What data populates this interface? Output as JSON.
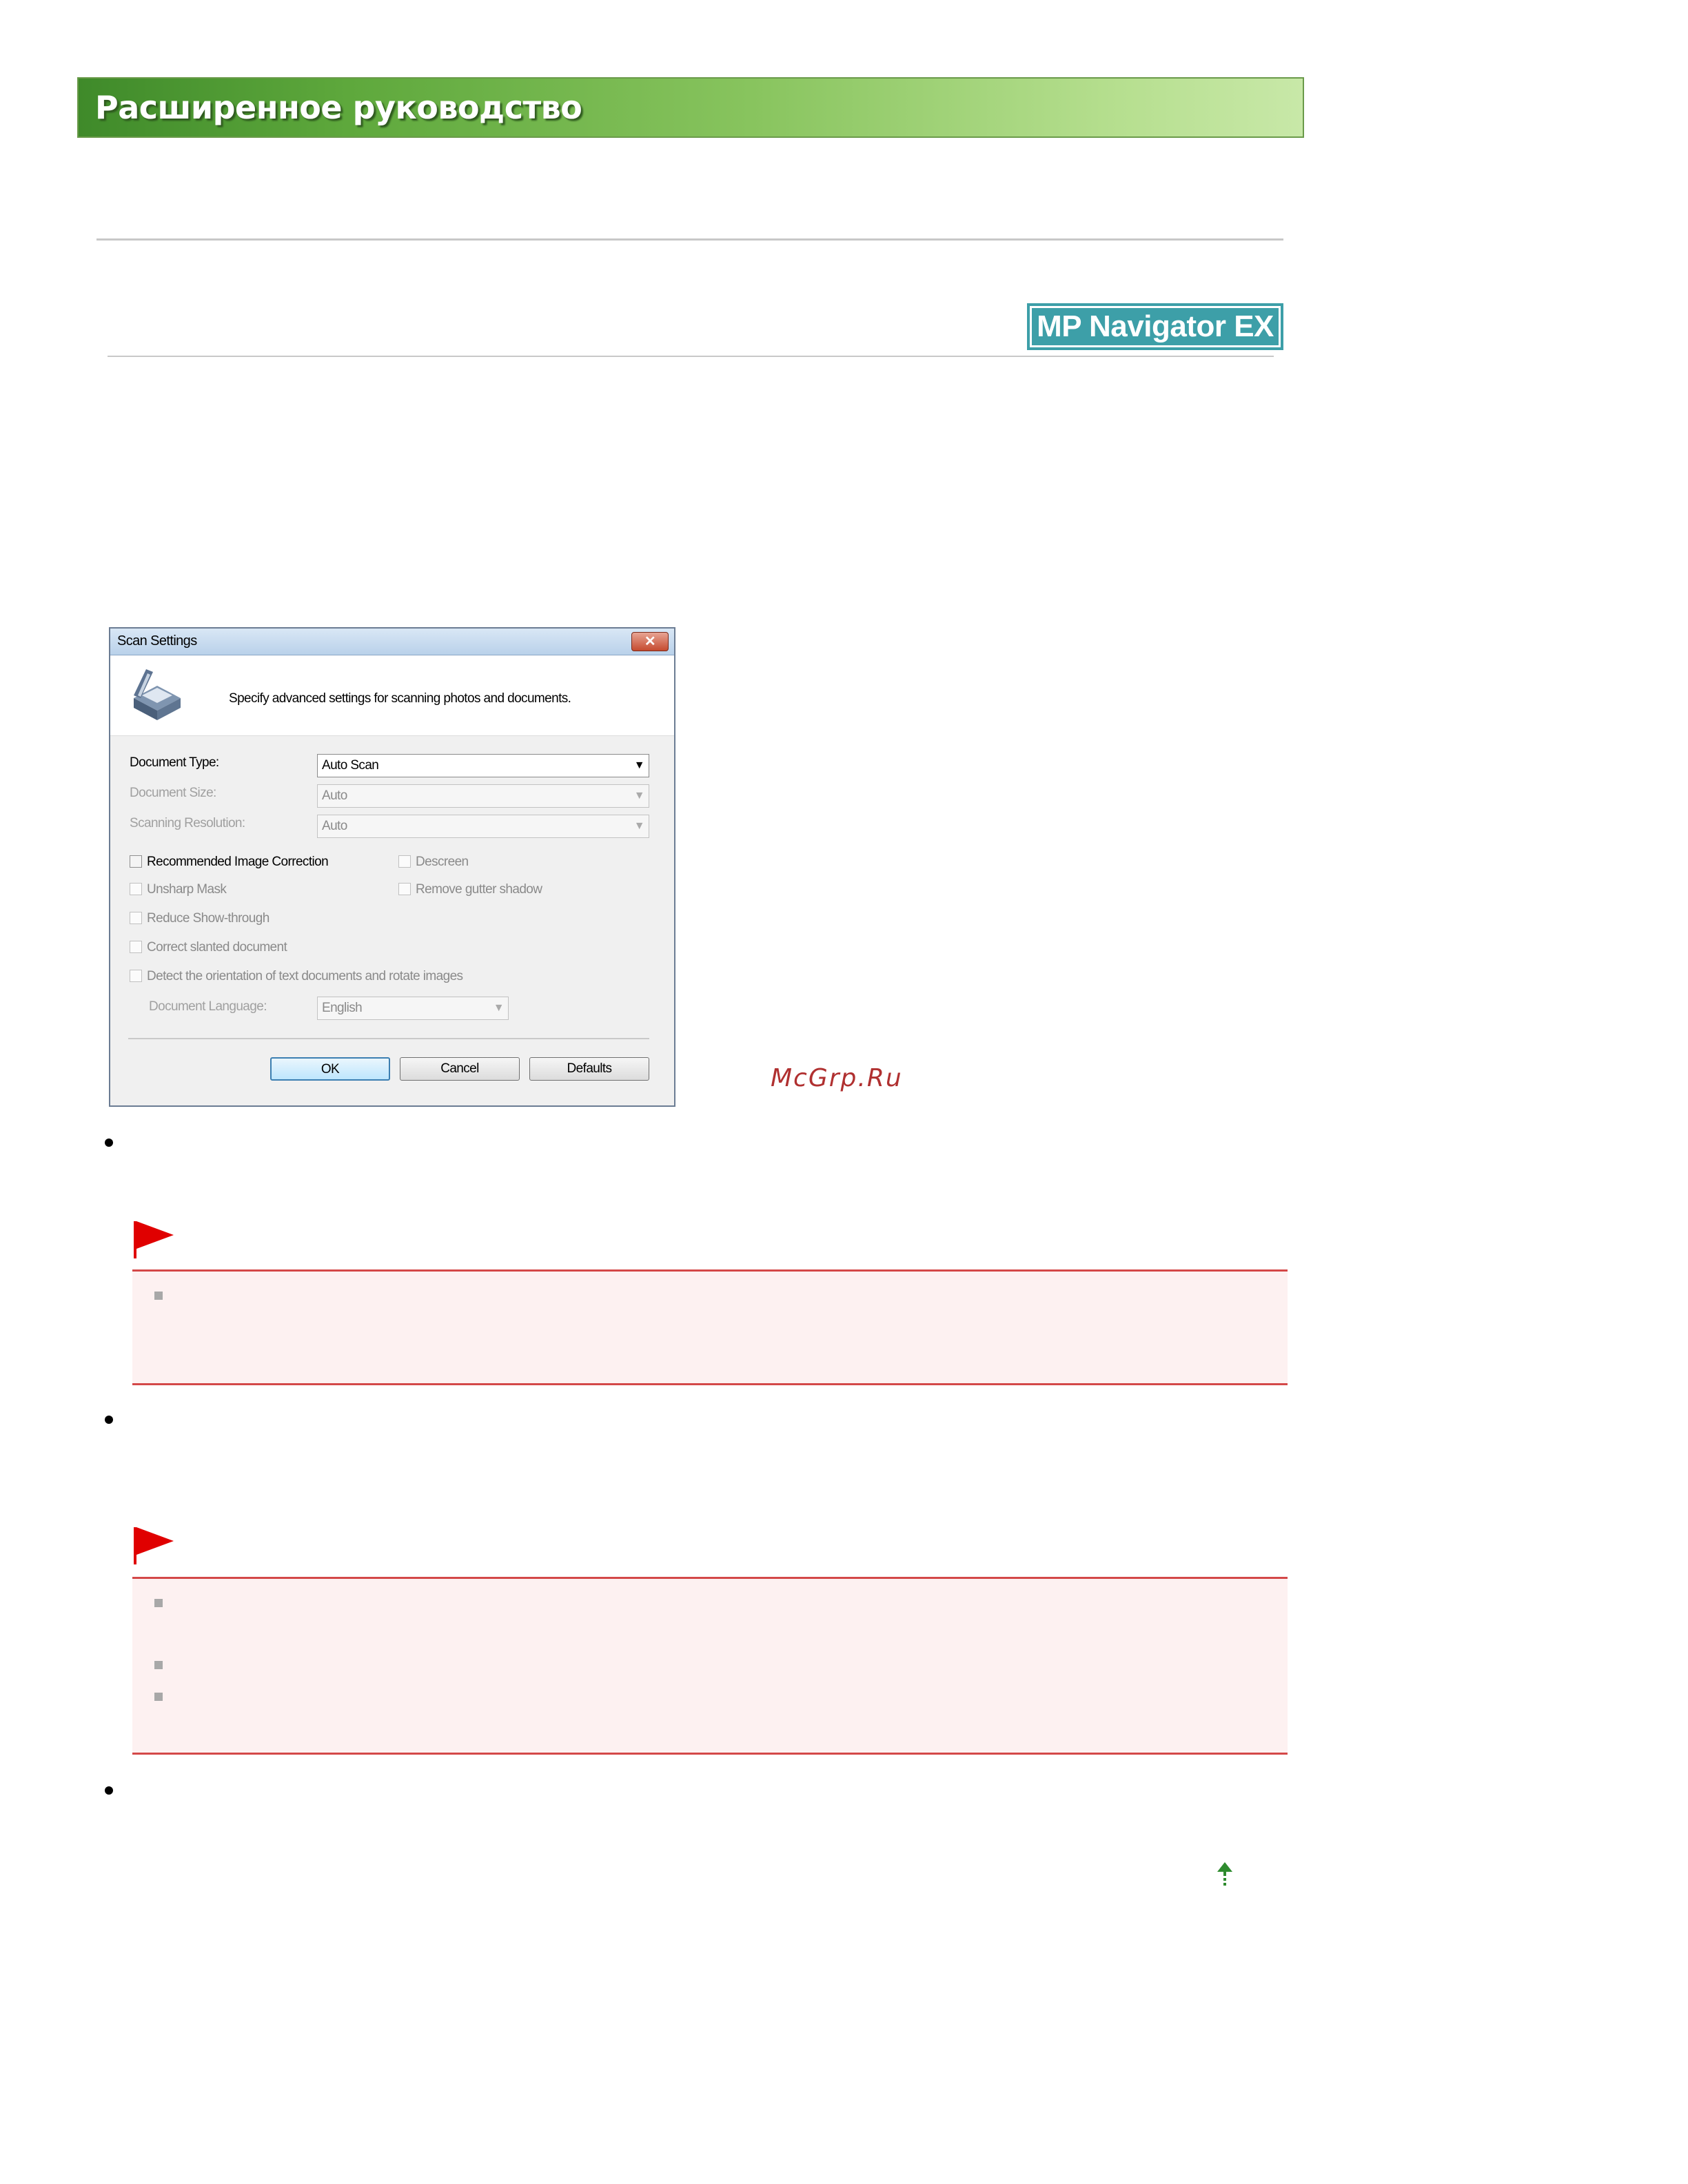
{
  "header": {
    "title": "Расширенное руководство",
    "product_badge": "MP Navigator EX",
    "watermark": "McGrp.Ru"
  },
  "dialog": {
    "title": "Scan Settings",
    "close_glyph": "✕",
    "description": "Specify advanced settings for scanning photos and documents.",
    "fields": {
      "document_type_label": "Document Type:",
      "document_type_value": "Auto Scan",
      "document_size_label": "Document Size:",
      "document_size_value": "Auto",
      "scanning_resolution_label": "Scanning Resolution:",
      "scanning_resolution_value": "Auto",
      "document_language_label": "Document Language:",
      "document_language_value": "English"
    },
    "checkboxes": {
      "recommended_image_correction": "Recommended Image Correction",
      "descreen": "Descreen",
      "unsharp_mask": "Unsharp Mask",
      "remove_gutter_shadow": "Remove gutter shadow",
      "reduce_show_through": "Reduce Show-through",
      "correct_slanted_document": "Correct slanted document",
      "detect_orientation": "Detect the orientation of text documents and rotate images"
    },
    "buttons": {
      "ok": "OK",
      "cancel": "Cancel",
      "defaults": "Defaults"
    }
  },
  "colors": {
    "banner_green": "#5ea83c",
    "badge_teal": "#3d9fa8",
    "important_red": "#d44848",
    "important_bg": "#fdf1f1",
    "top_link_green": "#2e8b2e"
  },
  "icons": {
    "important": "red-flag-icon",
    "list_item": "gray-square-icon",
    "back_to_top": "up-arrow-icon"
  }
}
